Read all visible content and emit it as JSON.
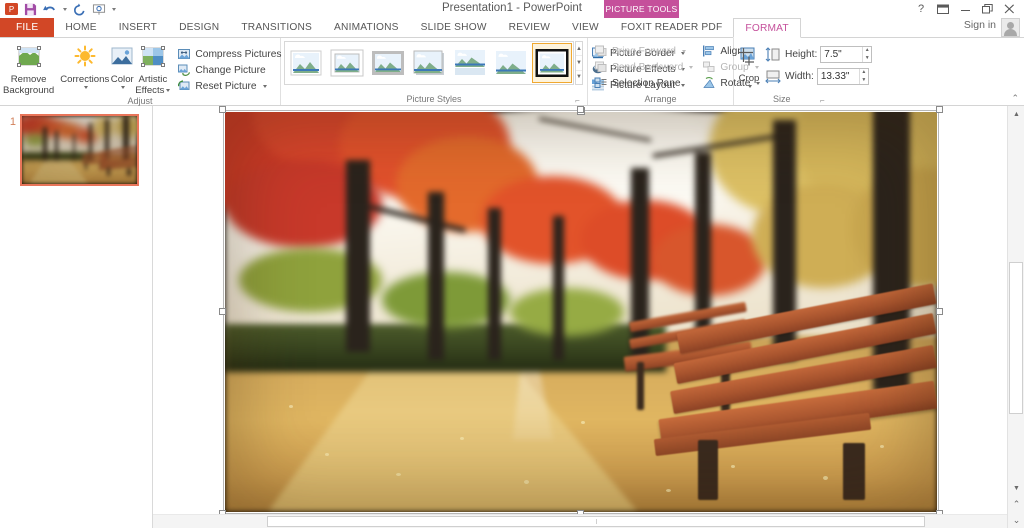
{
  "window": {
    "title": "Presentation1 - PowerPoint",
    "contextual_tab_group": "PICTURE TOOLS",
    "sign_in": "Sign in",
    "help_icon": "?",
    "ribbon_display_icon": "ribbon-display-options",
    "minimize_icon": "–",
    "restore_icon": "❐",
    "close_icon": "✕"
  },
  "qat": {
    "items": [
      {
        "name": "powerpoint-logo",
        "label": "P"
      },
      {
        "name": "save-icon",
        "label": "Save"
      },
      {
        "name": "undo-icon",
        "label": "Undo"
      },
      {
        "name": "redo-icon",
        "label": "Redo"
      },
      {
        "name": "start-slideshow-icon",
        "label": "Start From Beginning"
      },
      {
        "name": "customize-qat-icon",
        "label": "Customize Quick Access Toolbar"
      }
    ]
  },
  "tabs": [
    {
      "label": "FILE",
      "id": "file"
    },
    {
      "label": "HOME",
      "id": "home"
    },
    {
      "label": "INSERT",
      "id": "insert"
    },
    {
      "label": "DESIGN",
      "id": "design"
    },
    {
      "label": "TRANSITIONS",
      "id": "transitions"
    },
    {
      "label": "ANIMATIONS",
      "id": "animations"
    },
    {
      "label": "SLIDE SHOW",
      "id": "slide-show"
    },
    {
      "label": "REVIEW",
      "id": "review"
    },
    {
      "label": "VIEW",
      "id": "view"
    },
    {
      "label": "FOXIT READER PDF",
      "id": "foxit-reader-pdf"
    },
    {
      "label": "FORMAT",
      "id": "format"
    }
  ],
  "ribbon": {
    "groups": {
      "adjust": {
        "label": "Adjust",
        "remove_background": "Remove\nBackground",
        "remove_background_line1": "Remove",
        "remove_background_line2": "Background",
        "corrections": "Corrections",
        "color": "Color",
        "artistic_effects_line1": "Artistic",
        "artistic_effects_line2": "Effects",
        "compress_pictures": "Compress Pictures",
        "change_picture": "Change Picture",
        "reset_picture": "Reset Picture"
      },
      "picture_styles": {
        "label": "Picture Styles",
        "thumbnails": [
          {
            "name": "style-simple-frame-white",
            "selected": false
          },
          {
            "name": "style-beveled-matte-white",
            "selected": false
          },
          {
            "name": "style-metal-frame",
            "selected": false
          },
          {
            "name": "style-drop-shadow-rectangle",
            "selected": false
          },
          {
            "name": "style-reflected-rounded-rectangle",
            "selected": false
          },
          {
            "name": "style-soft-edge-rectangle",
            "selected": false
          },
          {
            "name": "style-double-frame-black",
            "selected": true
          }
        ],
        "picture_border": "Picture Border",
        "picture_effects": "Picture Effects",
        "picture_layout": "Picture Layout"
      },
      "arrange": {
        "label": "Arrange",
        "bring_forward": "Bring Forward",
        "send_backward": "Send Backward",
        "selection_pane": "Selection Pane",
        "align": "Align",
        "group": "Group",
        "rotate": "Rotate",
        "bring_forward_enabled": false,
        "send_backward_enabled": false,
        "group_enabled": false
      },
      "size": {
        "label": "Size",
        "crop": "Crop",
        "height_label": "Height:",
        "height_value": "7.5\"",
        "width_label": "Width:",
        "width_value": "13.33\""
      }
    }
  },
  "slides_pane": {
    "slides": [
      {
        "number": "1",
        "selected": true,
        "thumbnail": "autumn-park-benches-photo"
      }
    ]
  },
  "editor": {
    "selected_object": "picture-autumn-park-benches",
    "selection_handles": 8,
    "rotation_handle": true
  },
  "scrollbars": {
    "vertical_up_icon": "▲",
    "vertical_down_icon": "▼",
    "previous_slide_icon": "⌃",
    "next_slide_icon": "⌄"
  },
  "colors": {
    "file_tab": "#d24726",
    "contextual_accent": "#c5509b",
    "slide_selected_border": "#e8755a",
    "ribbon_bg": "#ffffff"
  }
}
